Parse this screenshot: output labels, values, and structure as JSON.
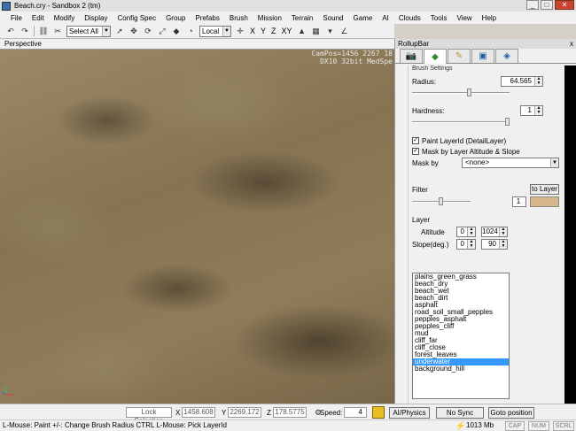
{
  "window": {
    "title": "Beach.cry - Sandbox 2 (tm)",
    "min": "_",
    "max": "□",
    "close": "✕"
  },
  "menu": [
    "File",
    "Edit",
    "Modify",
    "Display",
    "Config Spec",
    "Group",
    "Prefabs",
    "Brush",
    "Mission",
    "Terrain",
    "Sound",
    "Game",
    "AI",
    "Clouds",
    "Tools",
    "View",
    "Help"
  ],
  "toolbar": {
    "selection": "Select All",
    "coord_system": "Local",
    "axes": [
      "X",
      "Y",
      "Z",
      "XY"
    ]
  },
  "viewport": {
    "name": "Perspective",
    "cam_info": "CamPos=1456 2267 18\nDX10 32bit MedSpe"
  },
  "rollup": {
    "title": "RollupBar",
    "close": "x",
    "tabs": [
      "objects",
      "terrain",
      "brush",
      "display",
      "layers"
    ],
    "section_header": "Brush Settings",
    "radius_label": "Radius:",
    "radius_value": "64.565",
    "hardness_label": "Hardness:",
    "hardness_value": "1",
    "paint_layer_id_label": "Paint LayerId (DetailLayer)",
    "paint_layer_id_checked": true,
    "mask_altitude_label": "Mask by Layer Altitude & Slope",
    "mask_altitude_checked": true,
    "mask_by_label": "Mask by",
    "mask_by_value": "<none>",
    "filter_label": "Filter",
    "to_layer_label": "to Layer",
    "filter_spin": "1",
    "filter_color": "#d8b78a",
    "layer_label": "Layer",
    "altitude_label": "Altitude",
    "altitude_min": "0",
    "altitude_max": "1024",
    "slope_label": "Slope(deg.)",
    "slope_min": "0",
    "slope_max": "90",
    "layers": [
      "plains_green_grass",
      "beach_dry",
      "beach_wet",
      "beach_dirt",
      "asphalt",
      "road_soil_small_pepples",
      "pepples_asphalt",
      "pepples_cliff",
      "mud",
      "cliff_far",
      "cliff_close",
      "forest_leaves",
      "underwater",
      "background_hill"
    ],
    "selected_layer": "underwater"
  },
  "bottom": {
    "lock_selection": "Lock Selection",
    "x_label": "X",
    "x_value": "1458.608",
    "y_label": "Y",
    "y_value": "2269.172",
    "z_label": "Z",
    "z_value": "178.5775",
    "speed_label": "Speed:",
    "speed_value": "4",
    "ai_physics": "AI/Physics",
    "no_sync_player": "No Sync Player",
    "goto_position": "Goto position"
  },
  "status": {
    "text": "L-Mouse: Paint   +/-: Change Brush Radius   CTRL L-Mouse: Pick LayerId",
    "memory": "1013 Mb",
    "cap": "CAP",
    "num": "NUM",
    "scrl": "SCRL"
  },
  "colors": {
    "selection": "#3399ff",
    "filter_swatch": "#d8b78a"
  }
}
